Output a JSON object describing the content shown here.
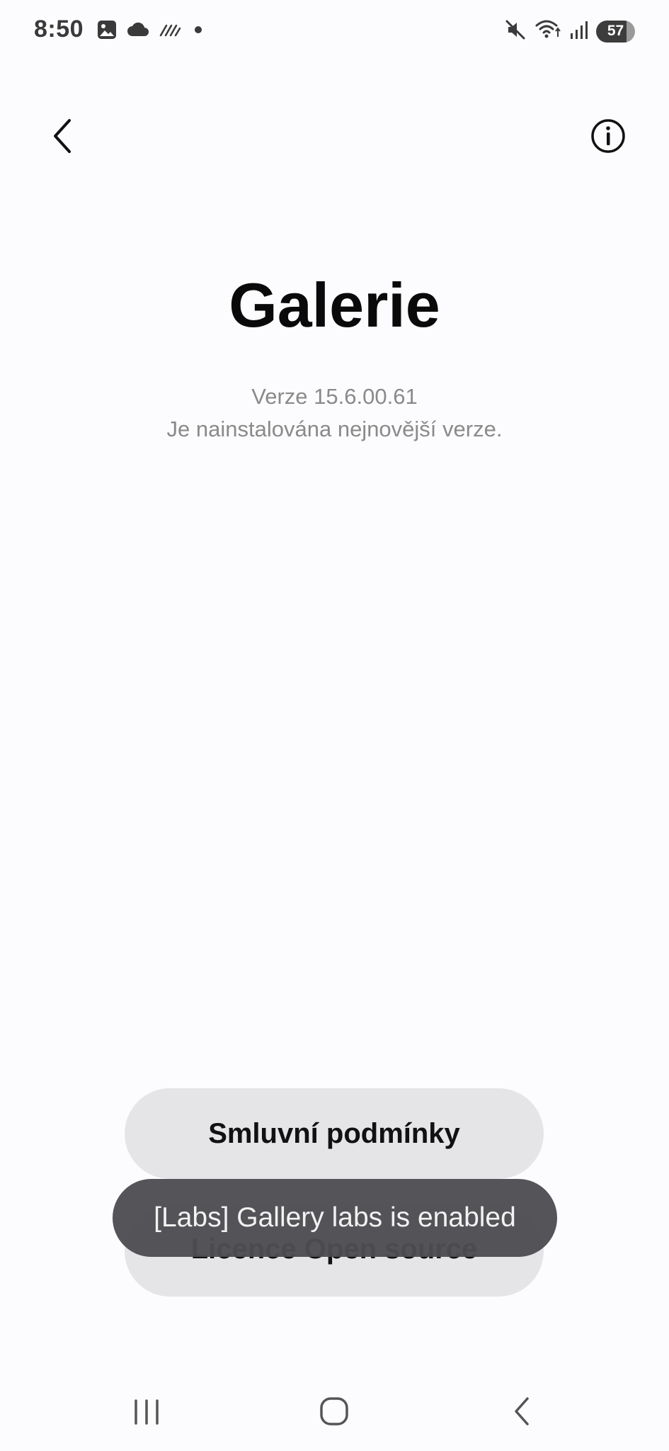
{
  "status_bar": {
    "time": "8:50",
    "battery_level": "57",
    "left_icons": [
      "image-icon",
      "cloud-icon",
      "sync-stripes-icon",
      "dot-icon"
    ],
    "right_icons": [
      "mute-icon",
      "wifi-icon",
      "signal-icon",
      "battery-icon"
    ]
  },
  "app_bar": {
    "back_icon": "chevron-left-icon",
    "info_icon": "info-circle-icon"
  },
  "app": {
    "name": "Galerie",
    "version": "Verze 15.6.00.61",
    "update_status": "Je nainstalována nejnovější verze."
  },
  "buttons": {
    "terms": "Smluvní podmínky",
    "license": "Licence Open source"
  },
  "toast": {
    "message": "[Labs] Gallery labs is enabled"
  },
  "nav_bar": {
    "icons": [
      "recents-icon",
      "home-icon",
      "back-icon"
    ]
  },
  "colors": {
    "background": "#fcfcfe",
    "button_bg": "#e5e5e8",
    "toast_bg": "#4e4e52",
    "secondary_text": "#8a8a8a"
  }
}
